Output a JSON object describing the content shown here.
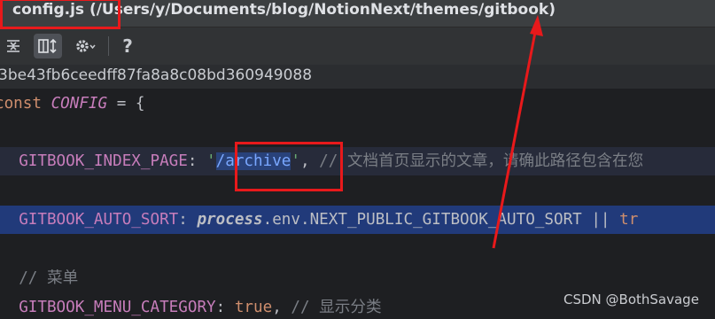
{
  "title_bar": {
    "title": "config.js (/Users/y/Documents/blog/NotionNext/themes/gitbook)"
  },
  "toolbar": {
    "buttons": [
      {
        "icon": "collapse-lines-icon"
      },
      {
        "icon": "diff-columns-icon"
      },
      {
        "icon": "gear-icon"
      },
      {
        "icon": "help-icon",
        "label": "?"
      }
    ]
  },
  "commit": {
    "hash": "3be43fb6ceedff87fa8a8c08bd360949088"
  },
  "editor": {
    "lines": [
      {
        "kw": "const",
        "name": "CONFIG",
        "rest": " = {"
      },
      {},
      {
        "key": "GITBOOK_INDEX_PAGE",
        "colon": ": ",
        "q1": "'",
        "value": "/archive",
        "q2": "'",
        "after": ", ",
        "comment_mark": "// ",
        "comment": "文档首页显示的文章，请确此路径包含在您"
      },
      {},
      {
        "key": "GITBOOK_AUTO_SORT",
        "colon": ": ",
        "fn": "process",
        "chain": ".env.NEXT_PUBLIC_GITBOOK_AUTO_SORT || ",
        "tail": "tr"
      },
      {},
      {
        "comment_mark": "// ",
        "comment": "菜单"
      },
      {
        "key": "GITBOOK_MENU_CATEGORY",
        "colon": ": ",
        "value": "true",
        "after": ", ",
        "comment_mark": "// ",
        "comment": "显示分类"
      }
    ]
  },
  "watermark": "CSDN @BothSavage",
  "colors": {
    "annotation_red": "#e8191b",
    "selection_line": "#213a7a",
    "editor_bg": "#1e1f22"
  }
}
